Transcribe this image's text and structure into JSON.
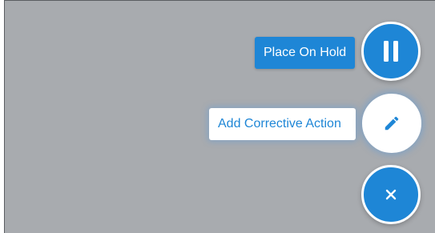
{
  "colors": {
    "overlay": "#a8abaf",
    "accent": "#1e86d6",
    "white": "#ffffff"
  },
  "actions": {
    "place_on_hold": {
      "label": "Place On Hold",
      "icon": "pause-icon"
    },
    "add_corrective_action": {
      "label": "Add Corrective Action",
      "icon": "pencil-icon"
    },
    "close": {
      "icon": "close-icon"
    }
  }
}
